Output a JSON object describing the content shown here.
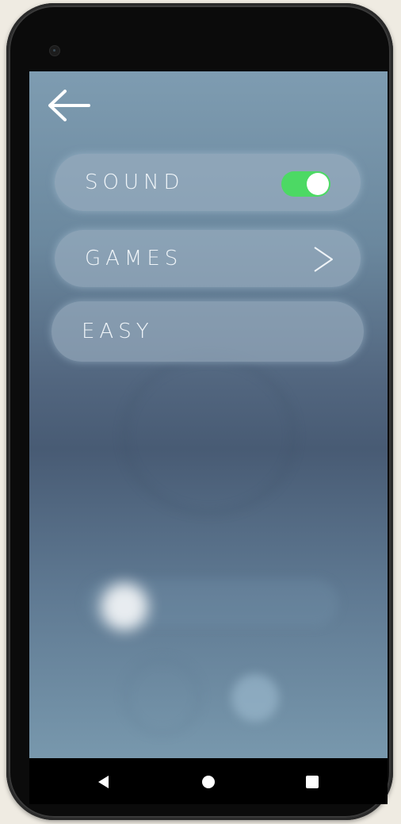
{
  "menu": {
    "items": [
      {
        "label": "SOUND",
        "control": "toggle",
        "toggle_on": true
      },
      {
        "label": "GAMES",
        "control": "chevron"
      },
      {
        "label": "EASY",
        "control": "none"
      }
    ]
  },
  "icons": {
    "back": "arrow-left-icon",
    "chevron": "chevron-right-icon",
    "nav_back": "triangle-back-icon",
    "nav_home": "circle-home-icon",
    "nav_recents": "square-recents-icon"
  },
  "colors": {
    "toggle_on": "#4cd964",
    "pill_bg": "#9eb2c4",
    "label_text": "#f0f5f9"
  }
}
